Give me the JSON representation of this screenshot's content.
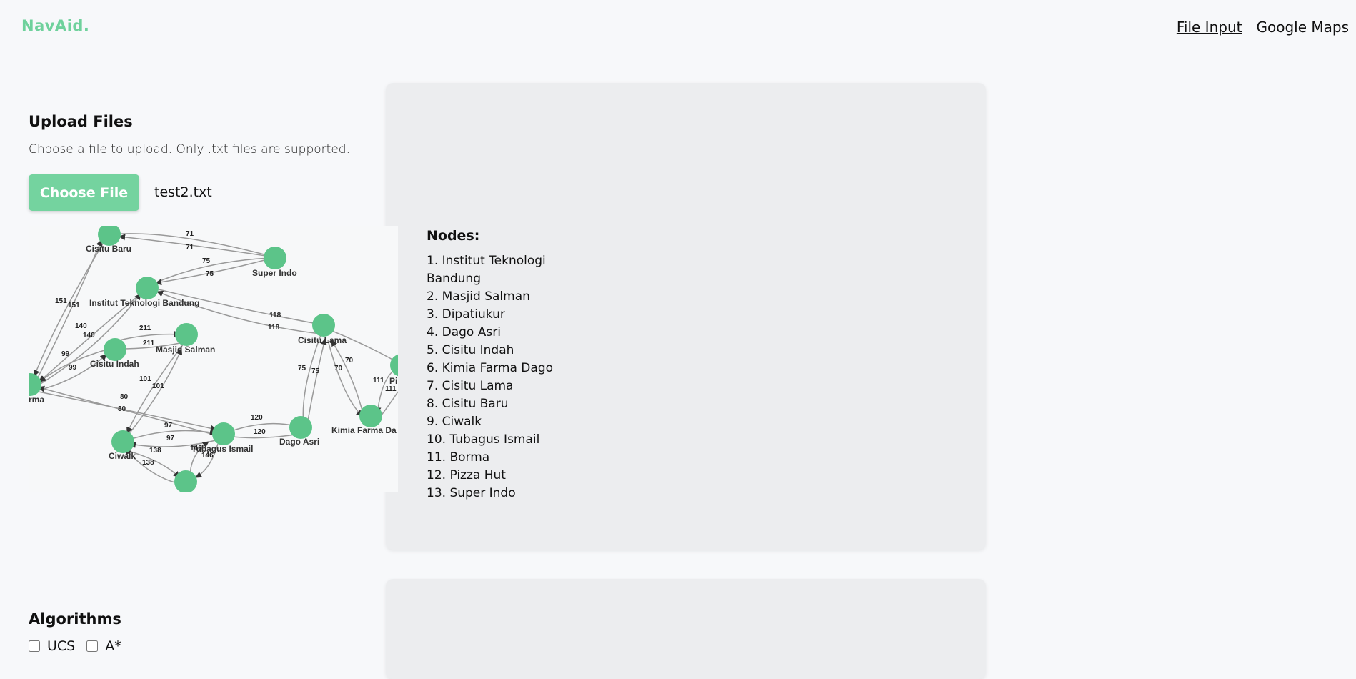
{
  "brand": "NavAid.",
  "nav": {
    "file_input": "File Input",
    "google_maps": "Google Maps"
  },
  "upload": {
    "title": "Upload Files",
    "subtitle": "Choose a file to upload. Only .txt files are supported.",
    "choose_label": "Choose File",
    "file_name": "test2.txt"
  },
  "graph": {
    "node_labels": {
      "cisitu_baru": "Cisitu Baru",
      "super_indo": "Super Indo",
      "itb": "Institut Teknologi Bandung",
      "masjid_salman": "Masjid Salman",
      "cisitu_indah": "Cisitu Indah",
      "borma": "rma",
      "cisitu_lama": "Cisitu Lama",
      "kimia_farma": "Kimia Farma Da",
      "pizza_hut": "Pi",
      "ciwalk": "Ciwalk",
      "tubagus": "Tubagus Ismail",
      "dago_asri": "Dago Asri"
    },
    "edge_labels": {
      "e71a": "71",
      "e71b": "71",
      "e75a": "75",
      "e75b": "75",
      "e151a": "151",
      "e151b": "151",
      "e140a": "140",
      "e140b": "140",
      "e99a": "99",
      "e99b": "99",
      "e211a": "211",
      "e211b": "211",
      "e118a": "118",
      "e118b": "118",
      "e101a": "101",
      "e101b": "101",
      "e75c": "75",
      "e75d": "75",
      "e70a": "70",
      "e70b": "70",
      "e111a": "111",
      "e111b": "111",
      "e80a": "80",
      "e80b": "80",
      "e120a": "120",
      "e120b": "120",
      "e97a": "97",
      "e97b": "97",
      "e138a": "138",
      "e138b": "138",
      "e146a": "146",
      "e146b": "146"
    }
  },
  "nodes_panel": {
    "title": "Nodes:",
    "items": [
      "1. Institut Teknologi Bandung",
      "2. Masjid Salman",
      "3. Dipatiukur",
      "4. Dago Asri",
      "5. Cisitu Indah",
      "6. Kimia Farma Dago",
      "7. Cisitu Lama",
      "8. Cisitu Baru",
      "9. Ciwalk",
      "10. Tubagus Ismail",
      "11. Borma",
      "12. Pizza Hut",
      "13. Super Indo"
    ]
  },
  "algorithms": {
    "title": "Algorithms",
    "options": [
      "UCS",
      "A*"
    ]
  },
  "colors": {
    "accent": "#74d39f",
    "node": "#5cc489",
    "card_bg": "#ecedef"
  }
}
